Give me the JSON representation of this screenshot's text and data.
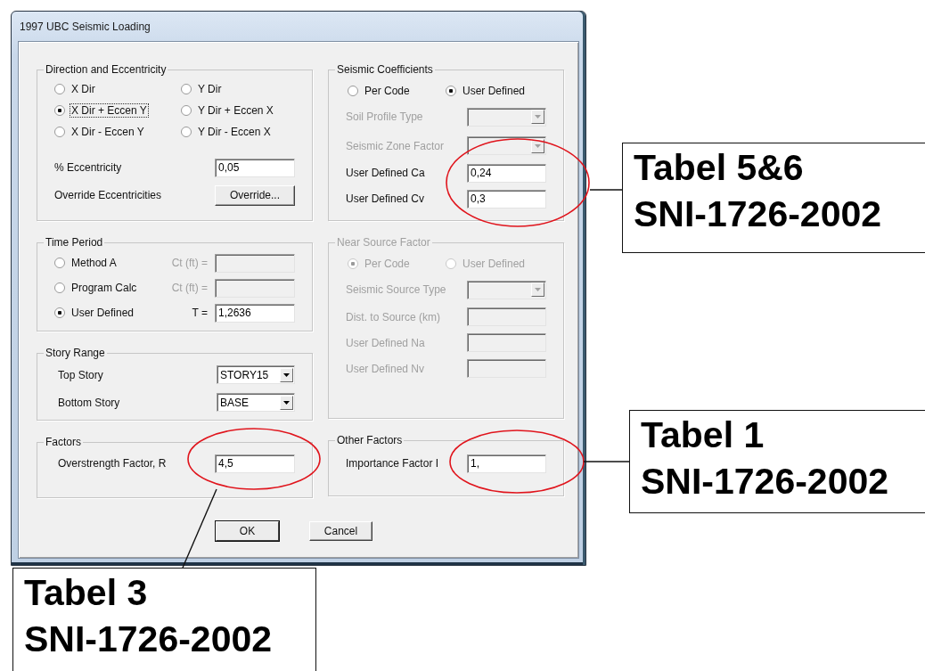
{
  "window": {
    "title": "1997 UBC Seismic Loading"
  },
  "direction_and_eccentricity": {
    "title": "Direction and Eccentricity",
    "options": [
      {
        "label": "X Dir",
        "selected": false,
        "focused": false
      },
      {
        "label": "Y Dir",
        "selected": false,
        "focused": false
      },
      {
        "label": "X Dir + Eccen Y",
        "selected": true,
        "focused": true
      },
      {
        "label": "Y Dir + Eccen X",
        "selected": false,
        "focused": false
      },
      {
        "label": "X Dir - Eccen Y",
        "selected": false,
        "focused": false
      },
      {
        "label": "Y Dir - Eccen X",
        "selected": false,
        "focused": false
      }
    ],
    "eccentricity": {
      "label": "% Eccentricity",
      "value": "0,05"
    },
    "override": {
      "label": "Override Eccentricities",
      "button": "Override..."
    }
  },
  "time_period": {
    "title": "Time Period",
    "options": [
      {
        "label": "Method A",
        "selected": false,
        "field_label": "Ct (ft) =",
        "disabled": true
      },
      {
        "label": "Program Calc",
        "selected": false,
        "field_label": "Ct (ft) =",
        "disabled": true
      },
      {
        "label": "User Defined",
        "selected": true,
        "field_label": "T =",
        "value": "1,2636",
        "disabled": false
      }
    ]
  },
  "story_range": {
    "title": "Story Range",
    "rows": [
      {
        "label": "Top Story",
        "value": "STORY15"
      },
      {
        "label": "Bottom Story",
        "value": "BASE"
      }
    ]
  },
  "factors": {
    "title": "Factors",
    "rows": [
      {
        "label": "Overstrength Factor, R",
        "value": "4,5"
      }
    ]
  },
  "seismic_coefficients": {
    "title": "Seismic Coefficients",
    "disabled": false,
    "options": [
      {
        "label": "Per Code",
        "selected": false
      },
      {
        "label": "User Defined",
        "selected": true
      }
    ],
    "fields": [
      {
        "kind": "dropdown",
        "label": "Soil Profile Type",
        "disabled": true
      },
      {
        "kind": "dropdown",
        "label": "Seismic Zone Factor",
        "disabled": true
      },
      {
        "kind": "text",
        "label": "User Defined  Ca",
        "value": "0,24",
        "disabled": false
      },
      {
        "kind": "text",
        "label": "User Defined  Cv",
        "value": "0,3",
        "disabled": false
      }
    ]
  },
  "near_source_factor": {
    "title": "Near Source Factor",
    "disabled": true,
    "options": [
      {
        "label": "Per Code",
        "selected": true
      },
      {
        "label": "User Defined",
        "selected": false
      }
    ],
    "fields": [
      {
        "kind": "dropdown",
        "label": "Seismic Source Type"
      },
      {
        "kind": "text",
        "label": "Dist. to Source (km)"
      },
      {
        "kind": "text",
        "label": "User Defined  Na"
      },
      {
        "kind": "text",
        "label": "User Defined  Nv"
      }
    ]
  },
  "other_factors": {
    "title": "Other Factors",
    "rows": [
      {
        "label": "Importance Factor  I",
        "value": "1,"
      }
    ]
  },
  "buttons": [
    {
      "label": "OK",
      "default": true
    },
    {
      "label": "Cancel",
      "default": false
    }
  ],
  "callouts": [
    {
      "lines": [
        "Tabel 5&6",
        "SNI-1726-2002"
      ]
    },
    {
      "lines": [
        "Tabel 1",
        "SNI-1726-2002"
      ]
    },
    {
      "lines": [
        "Tabel 3",
        "SNI-1726-2002"
      ]
    }
  ]
}
